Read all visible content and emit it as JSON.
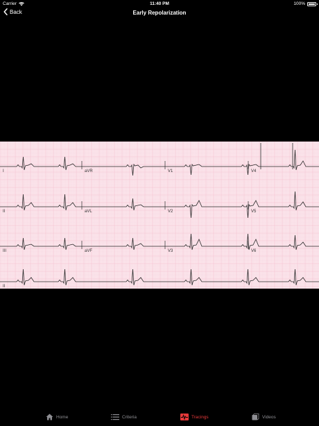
{
  "status": {
    "carrier": "Carrier",
    "time": "11:40 PM",
    "battery_text": "100%",
    "battery_level": 1.0
  },
  "nav": {
    "back_label": "Back",
    "title": "Early Repolarization"
  },
  "ecg": {
    "rows": [
      [
        "I",
        "aVR",
        "V1",
        "V4"
      ],
      [
        "II",
        "aVL",
        "V2",
        "V5"
      ],
      [
        "III",
        "aVF",
        "V3",
        "V6"
      ],
      [
        "II"
      ]
    ],
    "grid_color": "#f4b8c8",
    "background": "#fbe8ee",
    "trace_color": "#2b2b2b"
  },
  "tabs": [
    {
      "label": "Home",
      "icon": "home-icon",
      "active": false
    },
    {
      "label": "Criteria",
      "icon": "list-icon",
      "active": false
    },
    {
      "label": "Tracings",
      "icon": "ecg-icon",
      "active": true
    },
    {
      "label": "Videos",
      "icon": "video-icon",
      "active": false
    }
  ],
  "colors": {
    "accent": "#e5393a",
    "inactive": "#8e8e93"
  }
}
